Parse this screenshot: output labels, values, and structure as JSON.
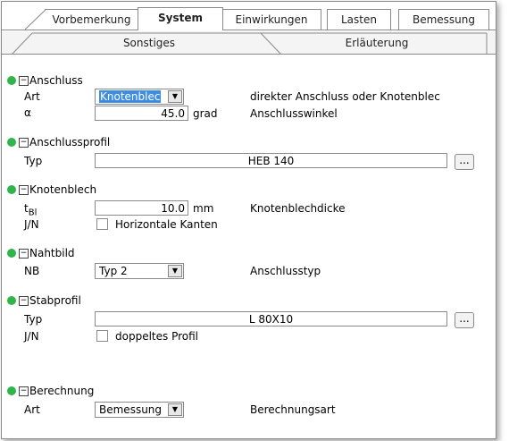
{
  "tabs_row1": [
    "Vorbemerkung",
    "System",
    "Einwirkungen",
    "Lasten",
    "Bemessung"
  ],
  "tabs_row2": [
    "Sonstiges",
    "Erläuterung"
  ],
  "anschluss": {
    "title": "Anschluss",
    "art_label": "Art",
    "art_value": "Knotenblec",
    "art_desc": "direkter Anschluss oder Knotenblec",
    "alpha_label": "α",
    "alpha_value": "45.0",
    "alpha_unit": "grad",
    "alpha_desc": "Anschlusswinkel"
  },
  "anschlussprofil": {
    "title": "Anschlussprofil",
    "typ_label": "Typ",
    "typ_value": "HEB 140",
    "button": "..."
  },
  "knotenblech": {
    "title": "Knotenblech",
    "t_label": "t",
    "t_sub": "Bl",
    "t_value": "10.0",
    "t_unit": "mm",
    "t_desc": "Knotenblechdicke",
    "jn_label": "J/N",
    "jn_text": "Horizontale Kanten"
  },
  "nahtbild": {
    "title": "Nahtbild",
    "nb_label": "NB",
    "nb_value": "Typ 2",
    "nb_desc": "Anschlusstyp"
  },
  "stabprofil": {
    "title": "Stabprofil",
    "typ_label": "Typ",
    "typ_value": "L 80X10",
    "button": "...",
    "jn_label": "J/N",
    "jn_text": "doppeltes Profil"
  },
  "berechnung": {
    "title": "Berechnung",
    "art_label": "Art",
    "art_value": "Bemessung",
    "art_desc": "Berechnungsart"
  },
  "colors": {
    "section_dot": "#2fb54a",
    "selection": "#3d8ee0"
  },
  "icons": {
    "collapse": "minus-box-icon",
    "dropdown": "chevron-down-icon"
  }
}
